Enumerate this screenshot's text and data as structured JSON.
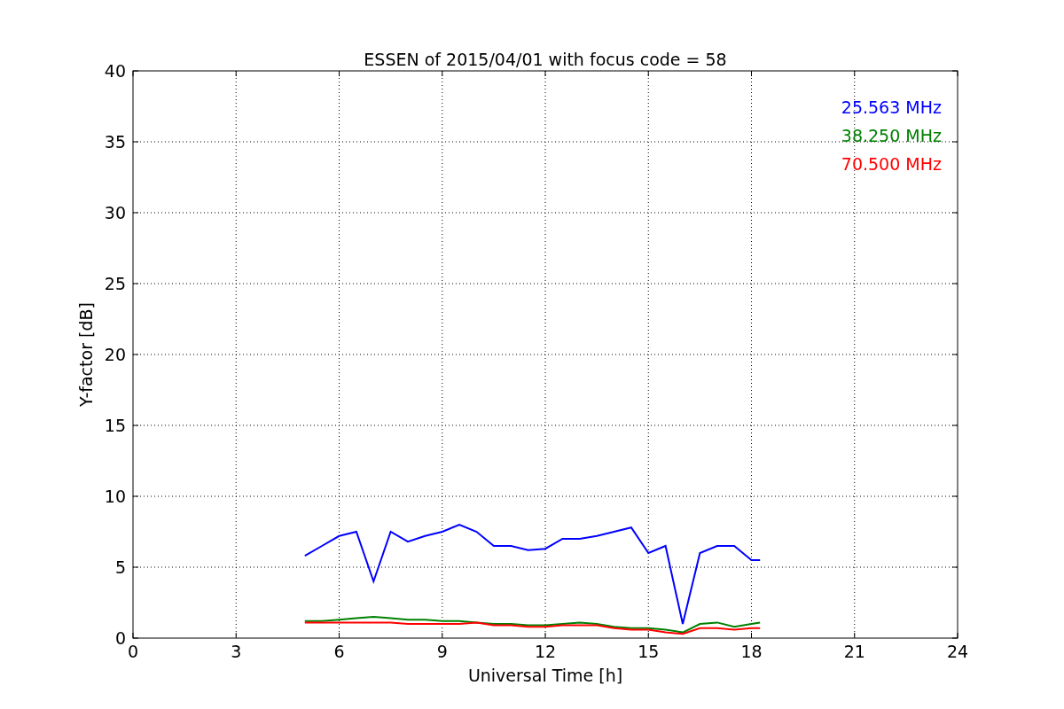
{
  "chart": {
    "chart_data": {
      "type": "line",
      "title": "ESSEN of 2015/04/01 with focus code = 58",
      "xlabel": "Universal Time [h]",
      "ylabel": "Y-factor [dB]",
      "x": [
        5,
        5.5,
        6,
        6.5,
        7,
        7.5,
        8,
        8.5,
        9,
        9.5,
        10,
        10.5,
        11,
        11.5,
        12,
        12.5,
        13,
        13.5,
        14,
        14.5,
        15,
        15.5,
        16,
        16.5,
        17,
        17.5,
        18,
        18.25
      ],
      "series": [
        {
          "name": "25.563 MHz",
          "color": "#0000ff",
          "values": [
            5.8,
            6.5,
            7.2,
            7.5,
            4,
            7.5,
            6.8,
            7.2,
            7.5,
            8,
            7.5,
            6.5,
            6.5,
            6.2,
            6.3,
            7,
            7,
            7.2,
            7.5,
            7.8,
            6,
            6.5,
            1,
            6,
            6.5,
            6.5,
            5.5,
            5.5
          ]
        },
        {
          "name": "38.250 MHz",
          "color": "#008000",
          "values": [
            1.2,
            1.2,
            1.3,
            1.4,
            1.5,
            1.4,
            1.3,
            1.3,
            1.2,
            1.2,
            1.1,
            1,
            1,
            0.9,
            0.9,
            1,
            1.1,
            1,
            0.8,
            0.7,
            0.7,
            0.6,
            0.4,
            1,
            1.1,
            0.8,
            1,
            1.1
          ]
        },
        {
          "name": "70.500 MHz",
          "color": "#ff0000",
          "values": [
            1.1,
            1.1,
            1.1,
            1.1,
            1.1,
            1.1,
            1,
            1,
            1,
            1,
            1.1,
            0.9,
            0.9,
            0.8,
            0.8,
            0.9,
            0.9,
            0.9,
            0.7,
            0.6,
            0.6,
            0.4,
            0.3,
            0.7,
            0.7,
            0.6,
            0.7,
            0.7
          ]
        }
      ],
      "grid": true,
      "xlim": [
        0,
        24
      ],
      "ylim": [
        0,
        40
      ],
      "xticks": [
        0,
        3,
        6,
        9,
        12,
        15,
        18,
        21,
        24
      ],
      "yticks": [
        0,
        5,
        10,
        15,
        20,
        25,
        30,
        35,
        40
      ]
    }
  }
}
